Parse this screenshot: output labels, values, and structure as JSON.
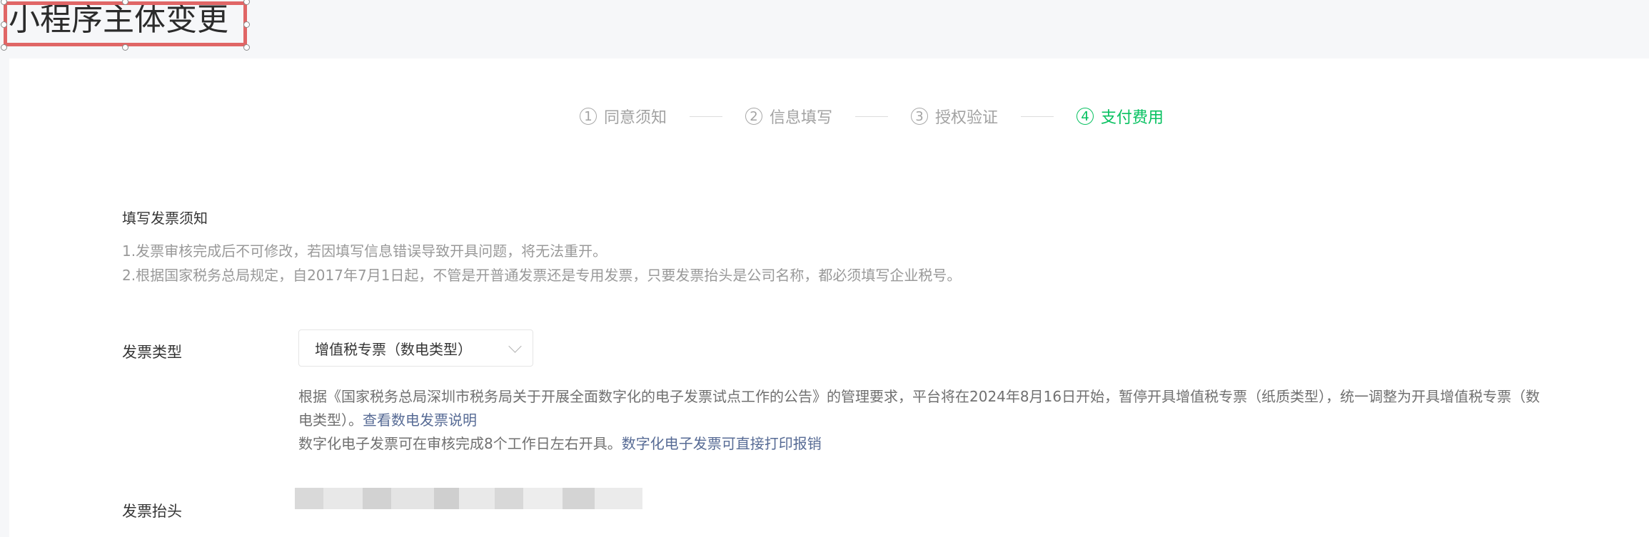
{
  "page": {
    "title": "小程序主体变更"
  },
  "steps": [
    {
      "num": "1",
      "label": "同意须知",
      "active": false
    },
    {
      "num": "2",
      "label": "信息填写",
      "active": false
    },
    {
      "num": "3",
      "label": "授权验证",
      "active": false
    },
    {
      "num": "4",
      "label": "支付费用",
      "active": true
    }
  ],
  "notice": {
    "title": "填写发票须知",
    "line1": "1.发票审核完成后不可修改，若因填写信息错误导致开具问题，将无法重开。",
    "line2": "2.根据国家税务总局规定，自2017年7月1日起，不管是开普通发票还是专用发票，只要发票抬头是公司名称，都必须填写企业税号。"
  },
  "invoice_type": {
    "label": "发票类型",
    "selected": "增值税专票（数电类型）",
    "desc_line1": "根据《国家税务总局深圳市税务局关于开展全面数字化的电子发票试点工作的公告》的管理要求，平台将在2024年8月16日开始，暂停开具增值税专票（纸质类型），统一调整为开具增值税专票（数",
    "desc_line2_prefix": "电类型）。",
    "desc_line2_link": "查看数电发票说明",
    "desc_line3_prefix": "数字化电子发票可在审核完成8个工作日左右开具。",
    "desc_line3_link": "数字化电子发票可直接打印报销"
  },
  "invoice_header": {
    "label": "发票抬头"
  },
  "colors": {
    "accent": "#07c160",
    "link": "#576b95",
    "selection": "#e06666"
  }
}
